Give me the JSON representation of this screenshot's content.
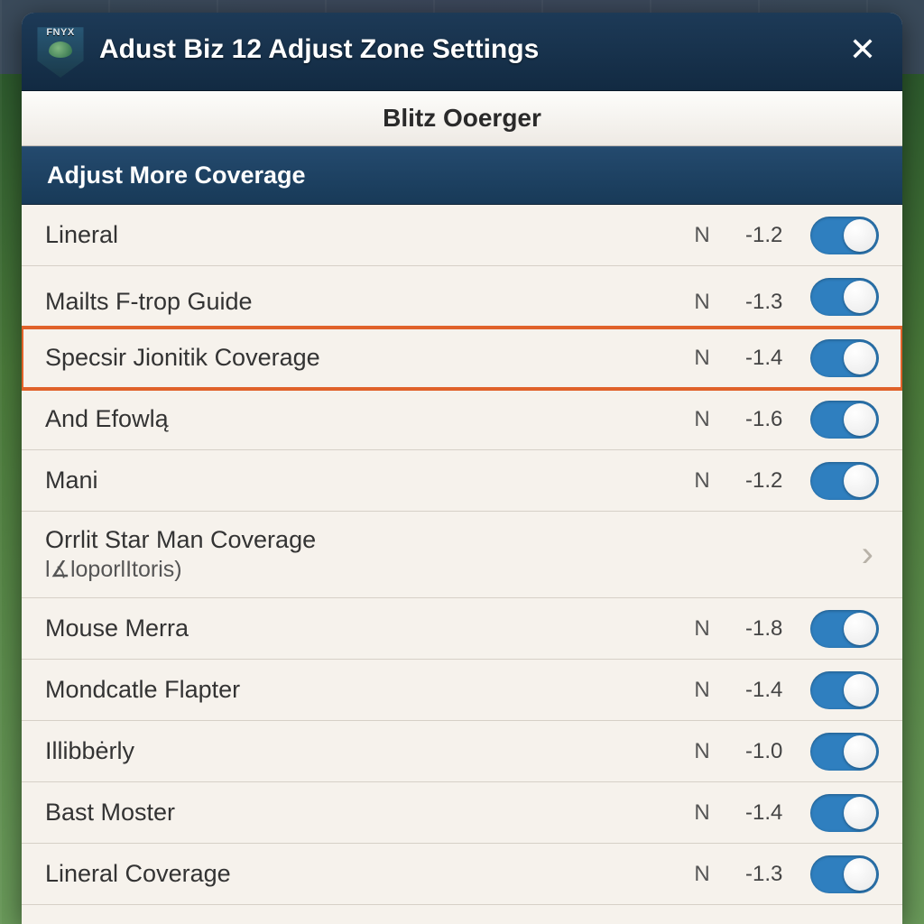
{
  "titlebar": {
    "logo_text": "FNYX",
    "title": "Adust Biz 12 Adjust Zone Settings",
    "close_label": "✕"
  },
  "subheader": {
    "label": "Blitz Ooerger"
  },
  "section": {
    "heading": "Adjust More Coverage"
  },
  "rows": [
    {
      "label": "Lineral",
      "n": "N",
      "value": "-1.2",
      "toggle": true,
      "type": "toggle"
    },
    {
      "label": "Mailts F-trop Guide",
      "n": "N",
      "value": "-1.3",
      "toggle": true,
      "type": "toggle",
      "truncated": true
    },
    {
      "label": "Specsir Jionitik Coverage",
      "n": "N",
      "value": "-1.4",
      "toggle": true,
      "type": "toggle",
      "highlight": true
    },
    {
      "label": "And Efowlą",
      "n": "N",
      "value": "-1.6",
      "toggle": true,
      "type": "toggle"
    },
    {
      "label": "Mani",
      "n": "N",
      "value": "-1.2",
      "toggle": true,
      "type": "toggle"
    },
    {
      "label": "Orrlit Star Man Coverage",
      "subtext": "l∡loporlItoris)",
      "type": "nav"
    },
    {
      "label": "Mouse Merra",
      "n": "N",
      "value": "-1.8",
      "toggle": true,
      "type": "toggle"
    },
    {
      "label": "Mondcatle Flapter",
      "n": "N",
      "value": "-1.4",
      "toggle": true,
      "type": "toggle"
    },
    {
      "label": "Illibbėrly",
      "n": "N",
      "value": "-1.0",
      "toggle": true,
      "type": "toggle"
    },
    {
      "label": "Bast Moster",
      "n": "N",
      "value": "-1.4",
      "toggle": true,
      "type": "toggle"
    },
    {
      "label": "Lineral Coverage",
      "n": "N",
      "value": "-1.3",
      "toggle": true,
      "type": "toggle"
    }
  ],
  "colors": {
    "accent": "#2f7fbf",
    "highlight_border": "#e0622a",
    "titlebar_bg": "#183a58"
  }
}
